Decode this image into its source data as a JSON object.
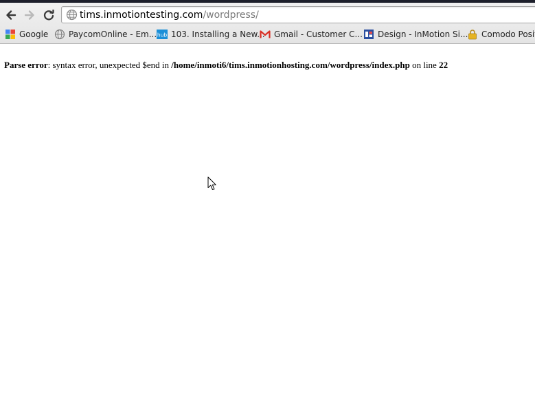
{
  "browser": {
    "address": {
      "host": "tims.inmotiontesting.com",
      "path": "/wordpress/"
    },
    "bookmarks": [
      {
        "label": "Google",
        "icon": "google-icon"
      },
      {
        "label": "PaycomOnline - Em...",
        "icon": "globe-icon"
      },
      {
        "label": "103. Installing a New...",
        "icon": "hub-icon",
        "icon_text": "hub"
      },
      {
        "label": "Gmail - Customer C...",
        "icon": "gmail-icon"
      },
      {
        "label": "Design - InMotion Si...",
        "icon": "document-icon"
      },
      {
        "label": "Comodo Positi",
        "icon": "lock-icon"
      }
    ]
  },
  "page": {
    "error_label": "Parse error",
    "error_message": ": syntax error, unexpected $end in ",
    "file_path": "/home/inmoti6/tims.inmotionhosting.com/wordpress/index.php",
    "line_text": " on line ",
    "line_number": "22"
  },
  "colors": {
    "chrome_bg": "#e8e8e8",
    "url_path": "#7a7a7a",
    "gmail_red": "#d93025",
    "hub_blue": "#1a8fd8"
  }
}
